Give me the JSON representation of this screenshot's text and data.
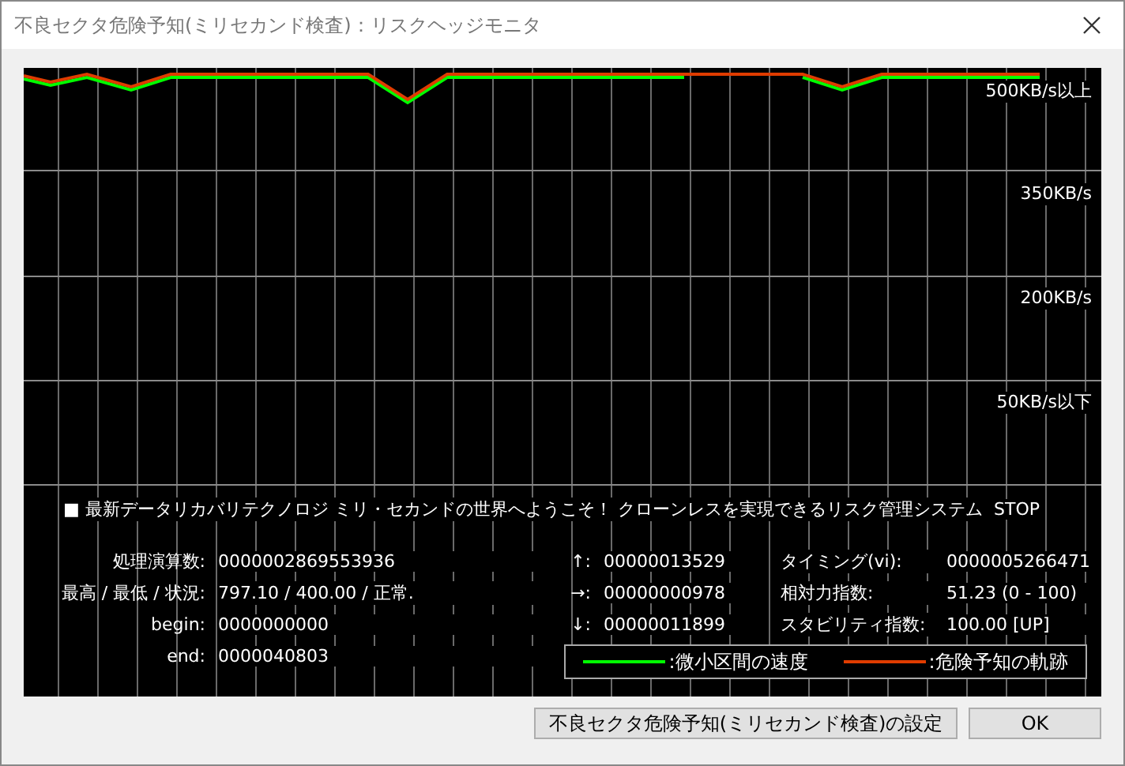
{
  "window": {
    "title": "不良セクタ危険予知(ミリセカンド検査)：リスクヘッジモニタ"
  },
  "chart": {
    "axis_labels": [
      "500KB/s以上",
      "350KB/s",
      "200KB/s",
      "50KB/s以下"
    ],
    "legend": [
      {
        "label": ":微小区間の速度",
        "color": "#00ff00"
      },
      {
        "label": ":危険予知の軌跡",
        "color": "#e03c00"
      }
    ]
  },
  "message": "■ 最新データリカバリテクノロジ ミリ・セカンドの世界へようこそ！ クローンレスを実現できるリスク管理システム",
  "status": "STOP",
  "stats": [
    {
      "label": "処理演算数:",
      "value": "0000002869553936"
    },
    {
      "label": "最高 / 最低 / 状況:",
      "value": "797.10 / 400.00 / 正常."
    },
    {
      "label": "begin:",
      "value": "0000000000"
    },
    {
      "label": "end:",
      "value": "0000040803"
    }
  ],
  "counters": [
    {
      "label": "↑:",
      "value": "00000013529"
    },
    {
      "label": "→:",
      "value": "00000000978"
    },
    {
      "label": "↓:",
      "value": "00000011899"
    }
  ],
  "indices": [
    {
      "label": "タイミング(vi):",
      "value": "0000005266471"
    },
    {
      "label": "相対力指数:",
      "value": "51.23 (0 - 100)"
    },
    {
      "label": "スタビリティ指数:",
      "value": "100.00 [UP]"
    }
  ],
  "buttons": [
    "不良セクタ危険予知(ミリセカンド検査)の設定",
    "OK"
  ]
}
